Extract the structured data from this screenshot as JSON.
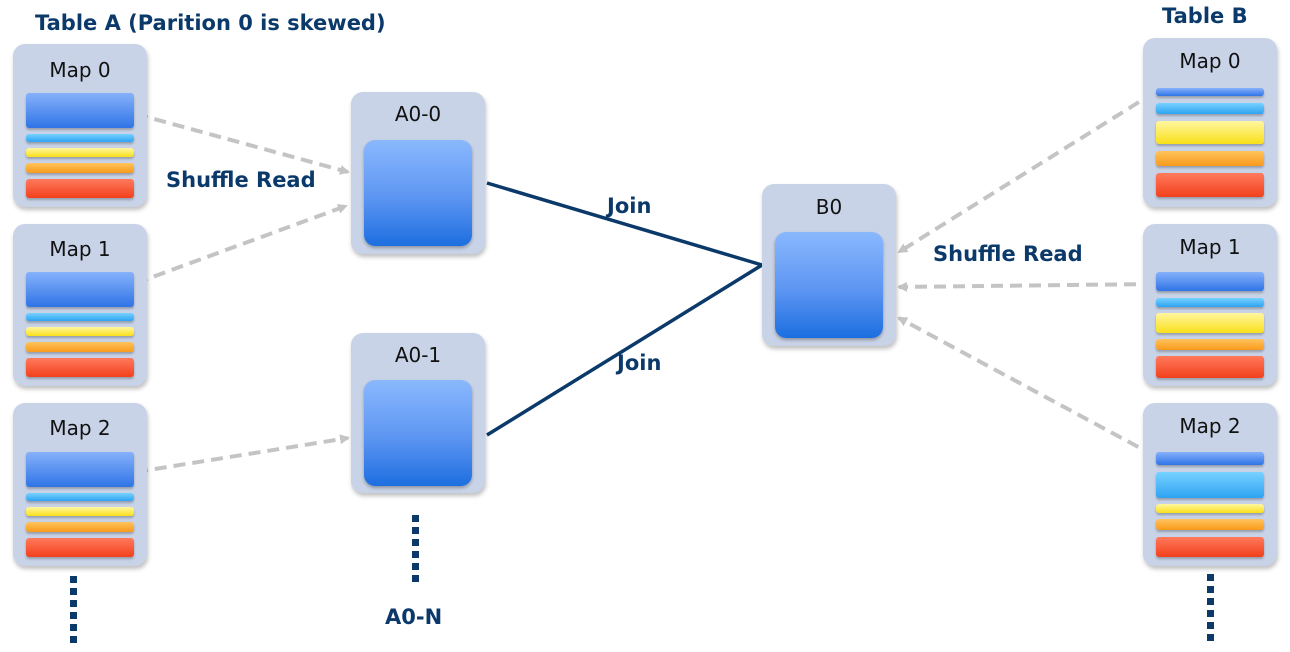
{
  "titles": {
    "table_a": "Table A (Parition 0 is skewed)",
    "table_b": "Table B"
  },
  "labels": {
    "shuffle_read_left": "Shuffle Read",
    "shuffle_read_right": "Shuffle Read",
    "join_top": "Join",
    "join_bottom": "Join",
    "a0_n": "A0-N"
  },
  "table_a_maps": [
    {
      "title": "Map 0",
      "partitions": [
        "blue-large",
        "cyan",
        "yellow",
        "orange",
        "red"
      ]
    },
    {
      "title": "Map 1",
      "partitions": [
        "blue-large",
        "cyan",
        "yellow",
        "orange",
        "red"
      ]
    },
    {
      "title": "Map 2",
      "partitions": [
        "blue-large",
        "cyan",
        "yellow",
        "orange",
        "red"
      ]
    }
  ],
  "table_b_maps": [
    {
      "title": "Map 0",
      "partitions": [
        "blue-thin",
        "cyan",
        "yellow-large",
        "orange",
        "red"
      ]
    },
    {
      "title": "Map 1",
      "partitions": [
        "blue",
        "cyan",
        "yellow",
        "orange",
        "red"
      ]
    },
    {
      "title": "Map 2",
      "partitions": [
        "blue-thin",
        "cyan-large",
        "yellow",
        "orange",
        "red"
      ]
    }
  ],
  "reduce_partitions": {
    "a0_0": "A0-0",
    "a0_1": "A0-1",
    "b0": "B0"
  },
  "colors": {
    "accent_navy": "#0b3a6a",
    "shuffle_arrow": "#c4c4c4",
    "card_bg": "#c9d3e7",
    "partition_blue": "#2f74e6",
    "partition_cyan": "#2ea3f2",
    "partition_yellow": "#f9e019",
    "partition_orange": "#f89a1c",
    "partition_red": "#f2401c"
  }
}
